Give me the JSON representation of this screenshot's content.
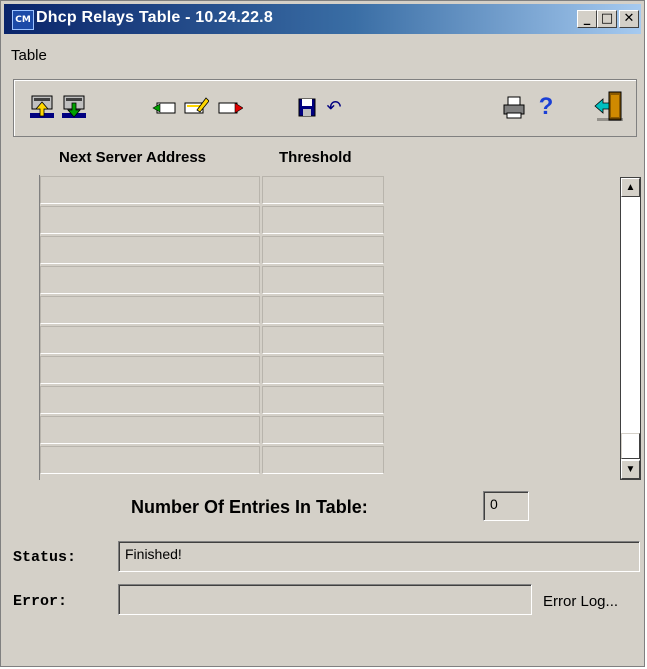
{
  "window": {
    "title": "Dhcp Relays Table - 10.24.22.8",
    "app_icon_text": "CM",
    "controls": {
      "minimize": "_",
      "maximize": "□",
      "close": "✕"
    }
  },
  "menu": {
    "items": [
      "Table"
    ]
  },
  "toolbar": {
    "buttons": [
      {
        "name": "upload-icon"
      },
      {
        "name": "download-icon"
      },
      {
        "name": "add-row-icon"
      },
      {
        "name": "edit-row-icon"
      },
      {
        "name": "export-row-icon"
      },
      {
        "name": "save-icon"
      },
      {
        "name": "undo-icon"
      },
      {
        "name": "print-icon"
      },
      {
        "name": "help-icon"
      },
      {
        "name": "exit-icon"
      }
    ],
    "help_glyph": "?",
    "undo_glyph": "↶"
  },
  "table": {
    "columns": [
      "Next Server Address",
      "Threshold"
    ],
    "rows": [
      [
        "",
        ""
      ],
      [
        "",
        ""
      ],
      [
        "",
        ""
      ],
      [
        "",
        ""
      ],
      [
        "",
        ""
      ],
      [
        "",
        ""
      ],
      [
        "",
        ""
      ],
      [
        "",
        ""
      ],
      [
        "",
        ""
      ],
      [
        "",
        ""
      ]
    ]
  },
  "scrollbar": {
    "up": "▲",
    "down": "▼"
  },
  "entries": {
    "label": "Number Of Entries In Table:",
    "value": "0"
  },
  "status": {
    "label": "Status:",
    "value": "Finished!"
  },
  "error": {
    "label": "Error:",
    "value": "",
    "log_link": "Error Log..."
  }
}
